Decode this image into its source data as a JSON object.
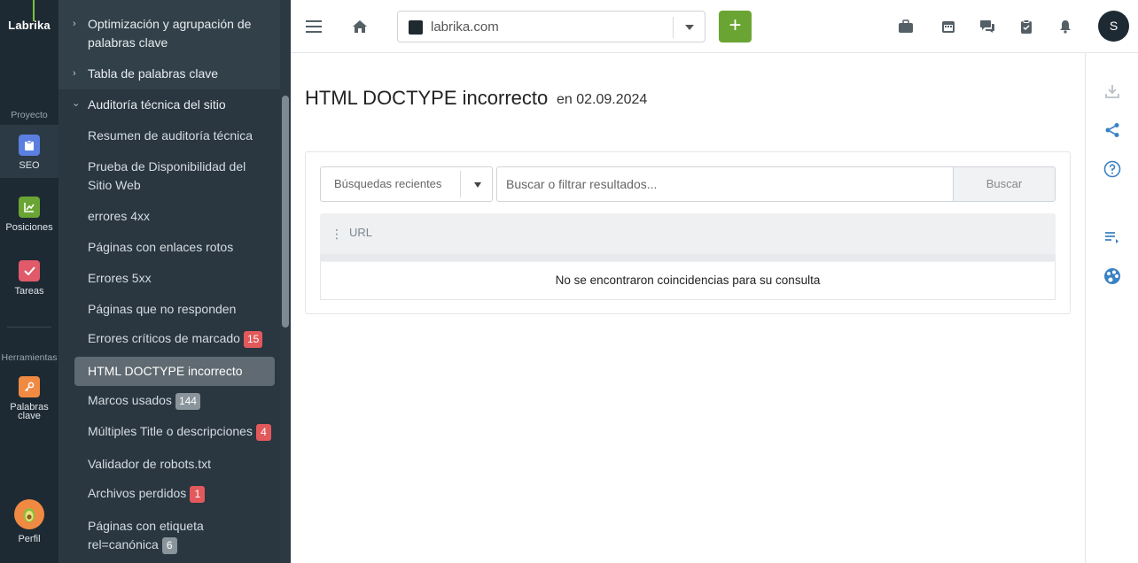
{
  "rail": {
    "logo": "Labrika",
    "project_label": "Proyecto",
    "tools_label": "Herramientas",
    "items": [
      {
        "label": "SEO",
        "icon": "clipboard-icon",
        "color": "#5b7fe0"
      },
      {
        "label": "Posiciones",
        "icon": "chart-icon",
        "color": "#6aa533"
      },
      {
        "label": "Tareas",
        "icon": "check-icon",
        "color": "#e05a6a"
      },
      {
        "label_1": "Palabras",
        "label_2": "clave",
        "icon": "key-icon",
        "color": "#f08a43"
      },
      {
        "label": "Perfil",
        "icon": "avocado-icon"
      }
    ]
  },
  "menu": {
    "items": [
      {
        "label": "Optimización y agrupación de palabras clave",
        "type": "parent"
      },
      {
        "label": "Tabla de palabras clave",
        "type": "parent"
      },
      {
        "label": "Auditoría técnica del sitio",
        "type": "parent-open"
      },
      {
        "label": "Resumen de auditoría técnica"
      },
      {
        "label": "Prueba de Disponibilidad del Sitio Web"
      },
      {
        "label": "errores 4xx"
      },
      {
        "label": "Páginas con enlaces rotos"
      },
      {
        "label": "Errores 5xx"
      },
      {
        "label": "Páginas que no responden"
      },
      {
        "label": "Errores críticos de marcado",
        "badge": "15",
        "badge_color": "red"
      },
      {
        "label": "HTML DOCTYPE incorrecto",
        "selected": true
      },
      {
        "label": "Marcos usados",
        "badge": "144",
        "badge_color": "gray"
      },
      {
        "label": "Múltiples Title o descripciones",
        "badge": "4",
        "badge_color": "red"
      },
      {
        "label": "Validador de robots.txt"
      },
      {
        "label": "Archivos perdidos",
        "badge": "1",
        "badge_color": "red"
      },
      {
        "label": "Páginas con etiqueta rel=canónica",
        "badge": "6",
        "badge_color": "gray"
      }
    ]
  },
  "header": {
    "site": "labrika.com",
    "add_label": "+",
    "user_initial": "S"
  },
  "main": {
    "title": "HTML DOCTYPE incorrecto",
    "date": "en 02.09.2024",
    "recent_searches": "Búsquedas recientes",
    "search_placeholder": "Buscar o filtrar resultados...",
    "search_button": "Buscar",
    "column_url": "URL",
    "empty_message": "No se encontraron coincidencias para su consulta"
  }
}
